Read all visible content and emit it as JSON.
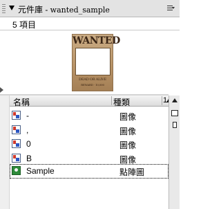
{
  "panel": {
    "title_prefix": "元件庫 - ",
    "title_file": "wanted_sample"
  },
  "library": {
    "count": "5 項目"
  },
  "preview": {
    "poster_title": "WANTED",
    "poster_line1": "DEAD OR ALIVE",
    "poster_line2": "REWARD · 10,000"
  },
  "table": {
    "headers": {
      "name": "名稱",
      "type": "種類",
      "sort": "1"
    },
    "rows": [
      {
        "name": "-",
        "type": "圖像",
        "icon": "image-symbol-icon"
      },
      {
        "name": ",",
        "type": "圖像",
        "icon": "image-symbol-icon"
      },
      {
        "name": "0",
        "type": "圖像",
        "icon": "image-symbol-icon"
      },
      {
        "name": "B",
        "type": "圖像",
        "icon": "image-symbol-icon"
      },
      {
        "name": "Sample",
        "type": "點陣圖",
        "icon": "bitmap-icon"
      }
    ]
  },
  "colors": {
    "poster_bg": "#b99468",
    "image_icon_red": "#d23a2c",
    "image_icon_blue": "#2c57c2",
    "bitmap_icon": "#2e8b3a"
  }
}
